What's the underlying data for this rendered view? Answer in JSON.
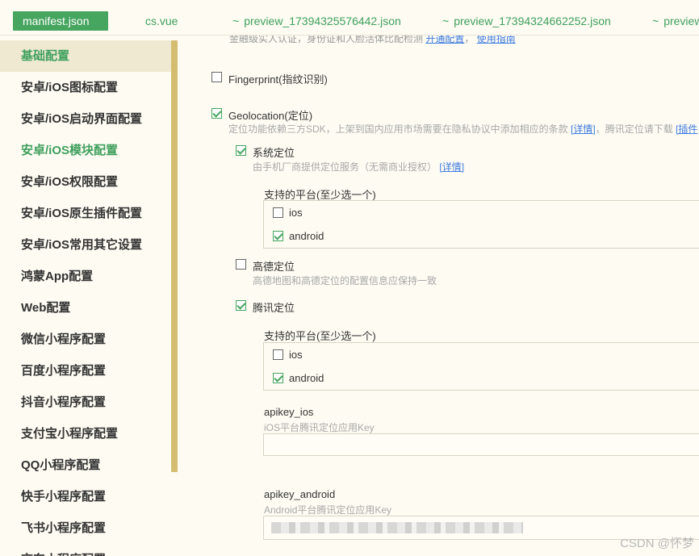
{
  "tabs": [
    {
      "label": "manifest.json",
      "active": true
    },
    {
      "label": "cs.vue"
    },
    {
      "prefix": "~",
      "label": "preview_17394325576442.json"
    },
    {
      "prefix": "~",
      "label": "preview_17394324662252.json"
    },
    {
      "prefix": "~",
      "label": "preview"
    }
  ],
  "sidebar": {
    "items": [
      {
        "label": "基础配置"
      },
      {
        "label": "安卓/iOS图标配置"
      },
      {
        "label": "安卓/iOS启动界面配置"
      },
      {
        "label": "安卓/iOS模块配置"
      },
      {
        "label": "安卓/iOS权限配置"
      },
      {
        "label": "安卓/iOS原生插件配置"
      },
      {
        "label": "安卓/iOS常用其它设置"
      },
      {
        "label": "鸿蒙App配置"
      },
      {
        "label": "Web配置"
      },
      {
        "label": "微信小程序配置"
      },
      {
        "label": "百度小程序配置"
      },
      {
        "label": "抖音小程序配置"
      },
      {
        "label": "支付宝小程序配置"
      },
      {
        "label": "QQ小程序配置"
      },
      {
        "label": "快手小程序配置"
      },
      {
        "label": "飞书小程序配置"
      },
      {
        "label": "京东小程序配置"
      }
    ]
  },
  "main": {
    "top_note": "金融级实人认证，身份证和人脸活体比配检测",
    "top_note_link1": "开通配置",
    "top_note_sep": "，",
    "top_note_link2": "使用指南",
    "fingerprint": {
      "label": "Fingerprint(指纹识别)",
      "checked": false
    },
    "geolocation": {
      "label": "Geolocation(定位)",
      "checked": true,
      "desc": "定位功能依赖三方SDK，上架到国内应用市场需要在隐私协议中添加相应的条款",
      "desc_link": "[详情]",
      "desc_tail": "，腾讯定位请下载",
      "desc_link2": "[插件"
    },
    "system_location": {
      "label": "系统定位",
      "checked": true,
      "desc": "由手机厂商提供定位服务（无需商业授权）",
      "desc_link": "[详情]",
      "platforms_title": "支持的平台(至少选一个)",
      "ios": {
        "label": "ios",
        "checked": false
      },
      "android": {
        "label": "android",
        "checked": true
      }
    },
    "amap_location": {
      "label": "高德定位",
      "checked": false,
      "desc": "高德地图和高德定位的配置信息应保持一致"
    },
    "tencent_location": {
      "label": "腾讯定位",
      "checked": true,
      "platforms_title": "支持的平台(至少选一个)",
      "ios": {
        "label": "ios",
        "checked": false
      },
      "android": {
        "label": "android",
        "checked": true
      },
      "apikey_ios_label": "apikey_ios",
      "apikey_ios_desc": "iOS平台腾讯定位应用Key",
      "apikey_ios_value": "",
      "apikey_android_label": "apikey_android",
      "apikey_android_desc": "Android平台腾讯定位应用Key"
    }
  },
  "watermark": "CSDN @怀梦"
}
